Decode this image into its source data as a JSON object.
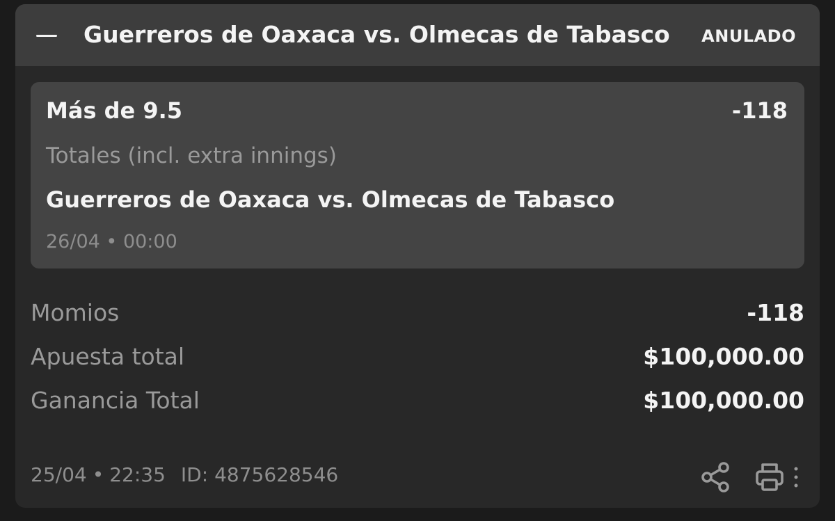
{
  "header": {
    "title": "Guerreros de Oaxaca vs. Olmecas de Tabasco",
    "status": "ANULADO"
  },
  "selection": {
    "pick": "Más de 9.5",
    "odds": "-118",
    "market": "Totales (incl. extra innings)",
    "event": "Guerreros de Oaxaca vs. Olmecas de Tabasco",
    "date": "26/04",
    "separator": "•",
    "time": "00:00"
  },
  "summary": {
    "momios_label": "Momios",
    "momios_value": "-118",
    "stake_label": "Apuesta total",
    "stake_value": "$100,000.00",
    "payout_label": "Ganancia Total",
    "payout_value": "$100,000.00"
  },
  "footer": {
    "date": "25/04",
    "separator": "•",
    "time": "22:35",
    "id_label": "ID:",
    "id_value": "4875628546",
    "icons": [
      "share-icon",
      "print-icon",
      "more-vertical-icon"
    ]
  },
  "colors": {
    "background": "#1b1b1b",
    "card": "#282828",
    "header": "#3d3d3d",
    "selection": "#444444",
    "text_primary": "#f4f4f4",
    "text_secondary": "#9a9a9a"
  }
}
